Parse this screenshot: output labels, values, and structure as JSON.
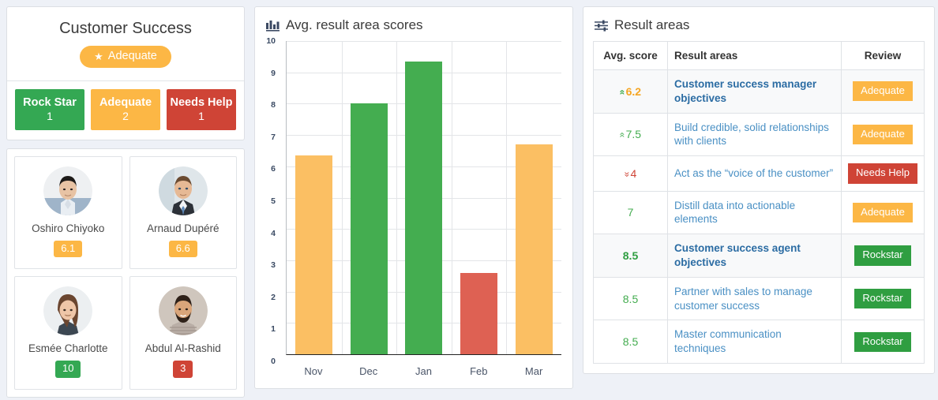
{
  "colors": {
    "green": "#43ac4f",
    "orange": "#fcb745",
    "red": "#cf4436",
    "bar_orange": "#fbbf63",
    "bar_green": "#44ad50",
    "bar_red": "#de6153",
    "link_blue": "#4a90c4",
    "page_bg": "#eef1f7"
  },
  "summary": {
    "title": "Customer Success",
    "rating_label": "Adequate",
    "rating_icon": "star-icon",
    "stats": [
      {
        "label": "Rock Star",
        "count": "1",
        "color": "#34a853"
      },
      {
        "label": "Adequate",
        "count": "2",
        "color": "#fcb745"
      },
      {
        "label": "Needs Help",
        "count": "1",
        "color": "#cf4436"
      }
    ]
  },
  "people": [
    {
      "name": "Oshiro Chiyoko",
      "score": "6.1",
      "badge_color": "#fcb745",
      "avatar": "asian-man-avatar"
    },
    {
      "name": "Arnaud Dupéré",
      "score": "6.6",
      "badge_color": "#fcb745",
      "avatar": "suited-man-avatar"
    },
    {
      "name": "Esmée Charlotte",
      "score": "10",
      "badge_color": "#34a853",
      "avatar": "smiling-woman-avatar"
    },
    {
      "name": "Abdul Al-Rashid",
      "score": "3",
      "badge_color": "#cf4436",
      "avatar": "bearded-man-avatar"
    }
  ],
  "chart_panel": {
    "title": "Avg. result area scores",
    "icon": "bar-chart-icon"
  },
  "chart_data": {
    "type": "bar",
    "title": "Avg. result area scores",
    "categories": [
      "Nov",
      "Dec",
      "Jan",
      "Feb",
      "Mar"
    ],
    "values": [
      6.35,
      8.0,
      9.35,
      2.6,
      6.7
    ],
    "colors": [
      "#fbbf63",
      "#44ad50",
      "#44ad50",
      "#de6153",
      "#fbbf63"
    ],
    "xlabel": "",
    "ylabel": "",
    "ylim": [
      0,
      10
    ],
    "yticks": [
      0,
      1,
      2,
      3,
      4,
      5,
      6,
      7,
      8,
      9,
      10
    ],
    "grid": true,
    "legend": false
  },
  "result_panel": {
    "title": "Result areas",
    "icon": "sliders-icon",
    "columns": [
      "Avg. score",
      "Result areas",
      "Review"
    ],
    "rows": [
      {
        "score": "6.2",
        "trend": "up",
        "score_color": "#f5a623",
        "area": "Customer success manager objectives",
        "bold": true,
        "shaded": true,
        "review": "Adequate",
        "review_color": "#fcb745"
      },
      {
        "score": "7.5",
        "trend": "up",
        "score_color": "#43ac4f",
        "area": "Build credible, solid relationships with clients",
        "bold": false,
        "shaded": false,
        "review": "Adequate",
        "review_color": "#fcb745"
      },
      {
        "score": "4",
        "trend": "down",
        "score_color": "#cf4436",
        "area": "Act as the “voice of the customer”",
        "bold": false,
        "shaded": false,
        "review": "Needs Help",
        "review_color": "#cf4436"
      },
      {
        "score": "7",
        "trend": "none",
        "score_color": "#43ac4f",
        "area": "Distill data into actionable elements",
        "bold": false,
        "shaded": false,
        "review": "Adequate",
        "review_color": "#fcb745"
      },
      {
        "score": "8.5",
        "trend": "none",
        "score_color": "#2f9e41",
        "area": "Customer success agent objectives",
        "bold": true,
        "shaded": true,
        "review": "Rockstar",
        "review_color": "#2f9e41"
      },
      {
        "score": "8.5",
        "trend": "none",
        "score_color": "#43ac4f",
        "area": "Partner with sales to manage customer success",
        "bold": false,
        "shaded": false,
        "review": "Rockstar",
        "review_color": "#2f9e41"
      },
      {
        "score": "8.5",
        "trend": "none",
        "score_color": "#43ac4f",
        "area": "Master communication techniques",
        "bold": false,
        "shaded": false,
        "review": "Rockstar",
        "review_color": "#2f9e41"
      }
    ]
  }
}
